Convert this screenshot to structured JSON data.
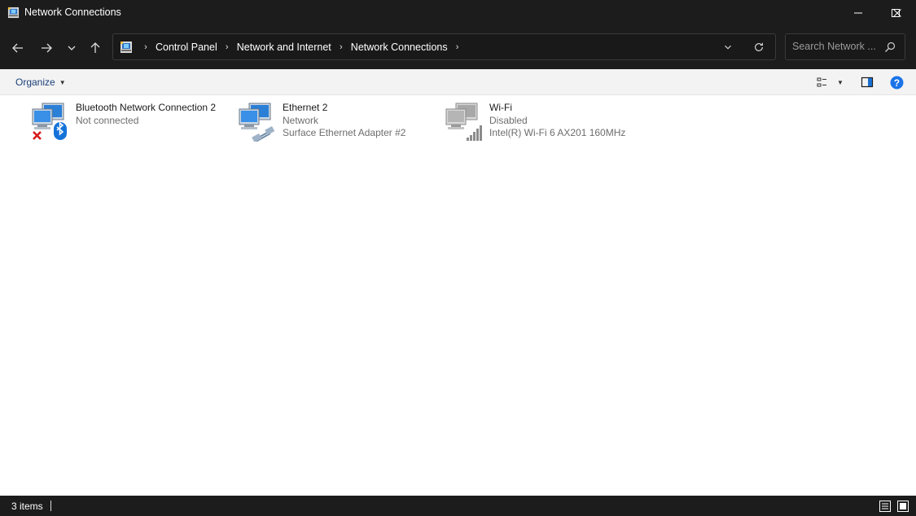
{
  "window": {
    "title": "Network Connections"
  },
  "address": {
    "crumbs": [
      "Control Panel",
      "Network and Internet",
      "Network Connections"
    ]
  },
  "search": {
    "placeholder": "Search Network ..."
  },
  "toolbar": {
    "organize_label": "Organize"
  },
  "connections": [
    {
      "name": "Bluetooth Network Connection 2",
      "status": "Not connected",
      "device": "",
      "icon": "bluetooth-network-icon"
    },
    {
      "name": "Ethernet 2",
      "status": "Network",
      "device": "Surface Ethernet Adapter #2",
      "icon": "ethernet-network-icon"
    },
    {
      "name": "Wi-Fi",
      "status": "Disabled",
      "device": "Intel(R) Wi-Fi 6 AX201 160MHz",
      "icon": "wifi-network-icon"
    }
  ],
  "statusbar": {
    "item_count": "3 items"
  },
  "colors": {
    "accent": "#0078d4",
    "title_bar": "#1c1c1c",
    "error_red": "#e81123"
  }
}
